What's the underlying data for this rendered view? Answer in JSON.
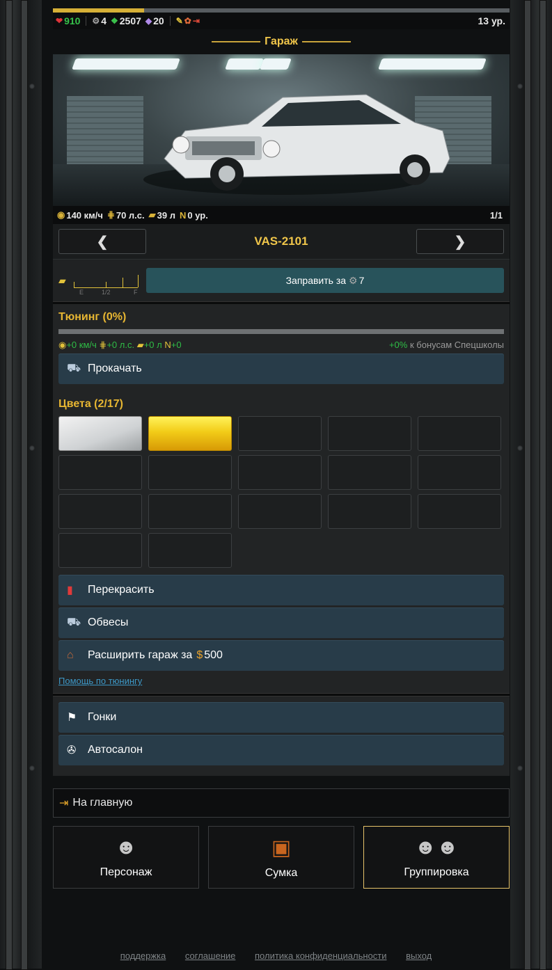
{
  "topbar": {
    "xp_fraction": 0.2,
    "hp": "910",
    "gears": "4",
    "cash": "2507",
    "crystals": "20",
    "level": "13 ур."
  },
  "page_title": "Гараж",
  "car": {
    "speed": "140 км/ч",
    "power": "70 л.с.",
    "fuel": "39 л",
    "nitro": "0 ур.",
    "page": "1/1",
    "name": "VAS-2101"
  },
  "fuel_gauge": {
    "e": "E",
    "half": "1/2",
    "f": "F"
  },
  "refuel_label": "Заправить за",
  "refuel_cost": "7",
  "tuning": {
    "title": "Тюнинг (0%)",
    "progress": 0,
    "speed": "+0 км/ч",
    "power": "+0 л.с.",
    "fuel": "+0 л",
    "nitro": "+0",
    "bonus_value": "+0%",
    "bonus_text": "к бонусам Спецшколы",
    "upgrade_label": "Прокачать"
  },
  "colors": {
    "title": "Цвета (2/17)",
    "swatches": [
      "silver",
      "gold",
      "",
      "",
      "",
      "",
      "",
      "",
      "",
      "",
      "",
      "",
      "",
      "",
      "",
      "",
      ""
    ]
  },
  "actions": {
    "repaint": "Перекрасить",
    "bodykits": "Обвесы",
    "expand_label": "Расширить гараж за",
    "expand_cost": "500",
    "help": "Помощь по тюнингу"
  },
  "links": {
    "races": "Гонки",
    "dealer": "Автосалон",
    "home": "На главную"
  },
  "tabs": {
    "character": "Персонаж",
    "bag": "Сумка",
    "gang": "Группировка"
  },
  "footer": {
    "support": "поддержка",
    "agreement": "соглашение",
    "privacy": "политика конфиденциальности",
    "logout": "выход"
  },
  "accent_colors": {
    "gold": "#f0c64a",
    "green": "#36c24a",
    "button": "#283c49"
  }
}
